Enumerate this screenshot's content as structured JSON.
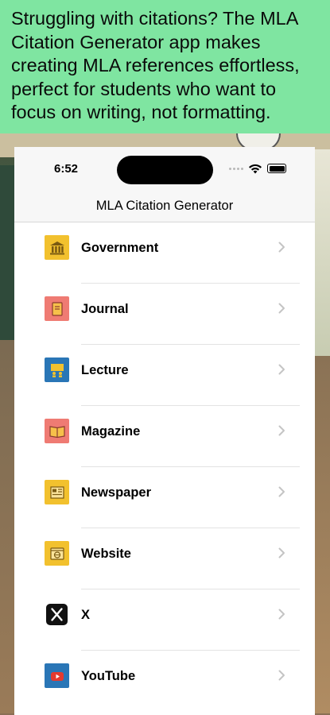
{
  "banner": {
    "text": "Struggling with citations? The MLA Citation Generator app makes creating MLA references effortless, perfect for students who want to focus on writing, not formatting."
  },
  "status_bar": {
    "time": "6:52"
  },
  "nav": {
    "title": "MLA Citation Generator"
  },
  "colors": {
    "banner_bg": "#7fe5a1",
    "yellow_icon": "#f2c12e",
    "salmon_icon": "#ef7b73",
    "blue_icon": "#2a76b6",
    "chevron": "#c4c4c4"
  },
  "list": {
    "items": [
      {
        "label": "Government",
        "icon": "government-building-icon"
      },
      {
        "label": "Journal",
        "icon": "journal-icon"
      },
      {
        "label": "Lecture",
        "icon": "lecture-icon"
      },
      {
        "label": "Magazine",
        "icon": "magazine-icon"
      },
      {
        "label": "Newspaper",
        "icon": "newspaper-icon"
      },
      {
        "label": "Website",
        "icon": "website-icon"
      },
      {
        "label": "X",
        "icon": "x-logo-icon"
      },
      {
        "label": "YouTube",
        "icon": "youtube-icon"
      }
    ]
  }
}
